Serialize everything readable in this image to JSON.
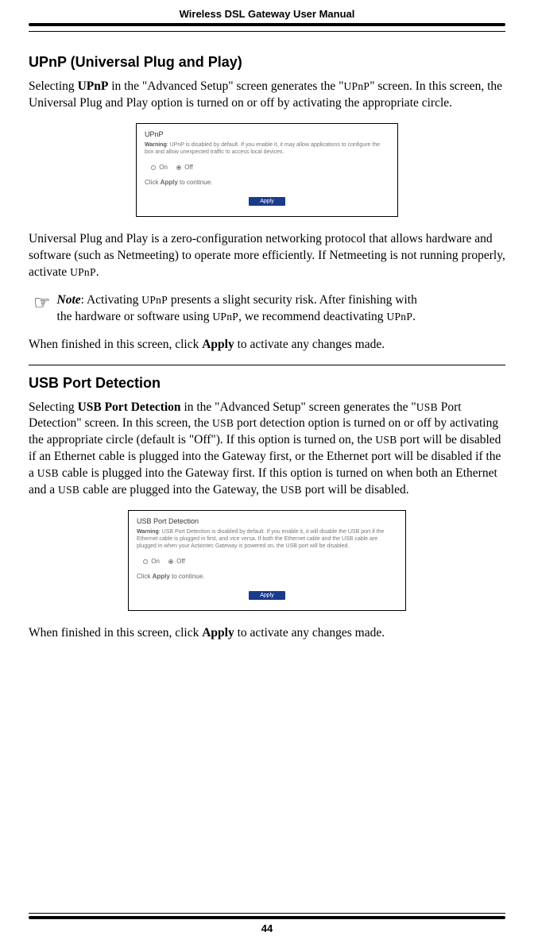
{
  "header": {
    "title": "Wireless DSL Gateway User Manual"
  },
  "upnp": {
    "heading": "UPnP (Universal Plug and Play)",
    "p1a": "Selecting ",
    "p1b": "UPnP",
    "p1c": " in the \"Advanced Setup\" screen generates the \"",
    "p1d": "UPnP",
    "p1e": "\" screen. In this screen, the Universal Plug and Play option is turned on or off by activating the appropriate circle.",
    "fig": {
      "title": "UPnP",
      "warn_label": "Warning",
      "warn_text": ": UPnP is disabled by default. If you enable it, it may allow applications to configure the box and allow unexpected traffic to access local devices.",
      "on": "On",
      "off": "Off",
      "continue_a": "Click ",
      "continue_b": "Apply",
      "continue_c": " to continue.",
      "apply": "Apply"
    },
    "p2a": "Universal Plug and Play is a zero-configuration networking protocol that allows hardware and software (such as Netmeeting) to operate more efficiently. If Netmeeting is not running properly, activate ",
    "p2b": "UPnP",
    "p2c": ".",
    "note_a": "Note",
    "note_b": ": Activating ",
    "note_c": "UPnP",
    "note_d": " presents a slight security risk. After finishing with the hardware or software using ",
    "note_e": "UPnP",
    "note_f": ", we recommend deactivating ",
    "note_g": "UPnP",
    "note_h": ".",
    "p3a": "When finished in this screen, click ",
    "p3b": "Apply",
    "p3c": " to activate any changes made."
  },
  "usb": {
    "heading": "USB Port Detection",
    "p1a": "Selecting ",
    "p1b": "USB Port Detection",
    "p1c": " in the \"Advanced Setup\" screen generates the \"",
    "p1d": "USB",
    "p1e": " Port Detection\" screen. In this screen, the ",
    "p1f": "USB",
    "p1g": " port detection option is turned on or off by activating the appropriate circle (default is \"Off\"). If this option is turned on, the ",
    "p1h": "USB",
    "p1i": " port will be disabled if an Ethernet cable is plugged into the Gateway first, or the Ethernet port will be disabled if the a ",
    "p1j": "USB",
    "p1k": " cable is plugged into the Gateway first. If this option is turned on when both an Ethernet and a ",
    "p1l": "USB",
    "p1m": " cable are plugged into the Gateway, the ",
    "p1n": "USB",
    "p1o": " port will be disabled.",
    "fig": {
      "title": "USB Port Detection",
      "warn_label": "Warning",
      "warn_text": ": USB Port Detection is disabled by default. If you enable it, it will disable the USB port if the Ethernet cable is plugged in first, and vice versa. If both the Ethernet cable and the USB cable are plugged in when your Actiontec Gateway is powered on, the USB port will be disabled.",
      "on": "On",
      "off": "Off",
      "continue_a": "Click ",
      "continue_b": "Apply",
      "continue_c": " to continue.",
      "apply": "Apply"
    },
    "p2a": "When finished in this screen, click ",
    "p2b": "Apply",
    "p2c": " to activate any changes made."
  },
  "footer": {
    "page": "44"
  }
}
